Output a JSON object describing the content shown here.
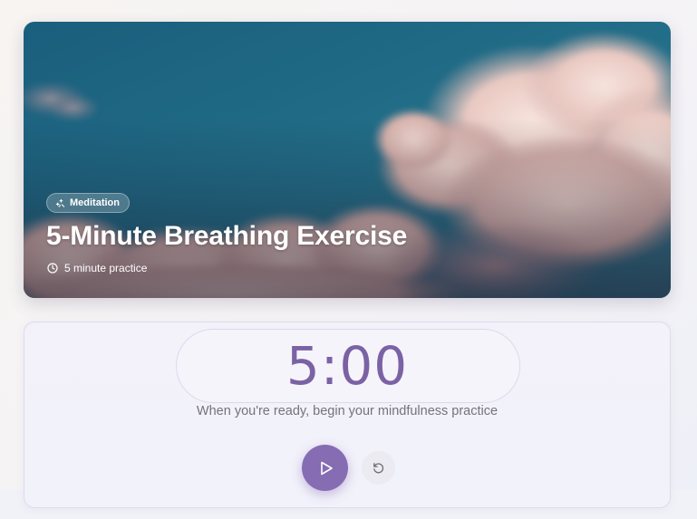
{
  "hero": {
    "category_tag": "Meditation",
    "category_icon": "sparkles-icon",
    "title": "5-Minute Breathing Exercise",
    "duration_label": "5 minute practice",
    "duration_icon": "clock-icon",
    "image_subject": "pink clouds against teal sky"
  },
  "timer": {
    "display": "5:00",
    "prompt": "When you're ready, begin your mindfulness practice",
    "play_icon": "play-icon",
    "reset_icon": "reset-icon"
  },
  "colors": {
    "accent": "#866cb3",
    "timer_text": "#7b62a4",
    "sky": "#1f6a86",
    "muted_text": "#76717f"
  }
}
